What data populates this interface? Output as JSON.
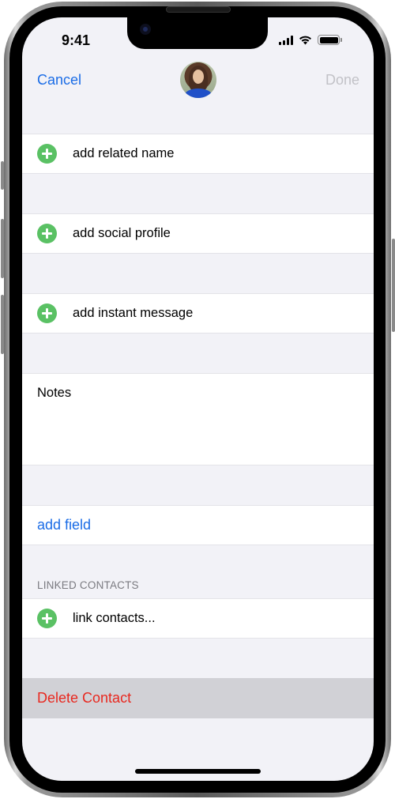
{
  "status_bar": {
    "time": "9:41",
    "icons": [
      "cellular-signal-icon",
      "wifi-icon",
      "battery-icon"
    ]
  },
  "nav": {
    "cancel_label": "Cancel",
    "done_label": "Done",
    "avatar": "contact-photo"
  },
  "fields": [
    {
      "icon": "add-circle-icon",
      "label": "add related name"
    },
    {
      "icon": "add-circle-icon",
      "label": "add social profile"
    },
    {
      "icon": "add-circle-icon",
      "label": "add instant message"
    }
  ],
  "notes": {
    "label": "Notes",
    "value": ""
  },
  "add_field_label": "add field",
  "linked_contacts": {
    "header": "LINKED CONTACTS",
    "link_label": "link contacts..."
  },
  "delete_label": "Delete Contact",
  "colors": {
    "accent": "#1a6ce6",
    "add_green": "#5ac164",
    "destructive": "#e8281f",
    "disabled": "#c2c2c7",
    "background": "#f2f2f7"
  }
}
